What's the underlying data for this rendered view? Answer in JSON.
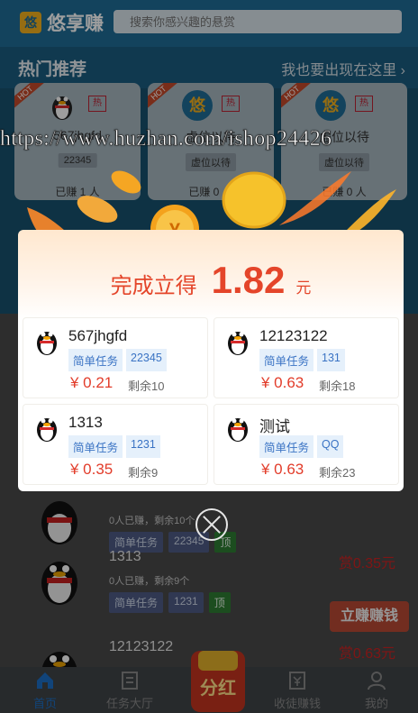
{
  "app": {
    "name": "悠享赚",
    "logo_char": "悠"
  },
  "search": {
    "placeholder": "搜索你感兴趣的悬赏"
  },
  "hot": {
    "title": "热门推荐",
    "link": "我也要出现在这里 ›",
    "cards": [
      {
        "ribbon": "HOT",
        "tag": "热",
        "name": "567jhgfd",
        "sub": "22345",
        "done": "已赚 1 人"
      },
      {
        "ribbon": "HOT",
        "tag": "热",
        "name": "虚位以待",
        "sub": "虚位以待",
        "done": "已赚 0 人"
      },
      {
        "ribbon": "HOT",
        "tag": "热",
        "name": "虚位以待",
        "sub": "虚位以待",
        "done": "已赚 0 人"
      }
    ]
  },
  "list": [
    {
      "name": "",
      "meta": "0人已赚，剩余10个",
      "tags": [
        "简单任务",
        "22345",
        "顶"
      ],
      "reward": "",
      "button": ""
    },
    {
      "name": "1313",
      "meta": "0人已赚，剩余9个",
      "tags": [
        "简单任务",
        "1231",
        "顶"
      ],
      "reward": "赏0.35元",
      "button": "立赚赚钱"
    },
    {
      "name": "12123122",
      "meta": "",
      "tags": [],
      "reward": "赏0.63元",
      "button": ""
    }
  ],
  "tabs": [
    {
      "label": "首页",
      "icon": "home-icon"
    },
    {
      "label": "任务大厅",
      "icon": "list-icon"
    },
    {
      "label": "收徒赚钱",
      "icon": "money-icon"
    },
    {
      "label": "我的",
      "icon": "user-icon"
    }
  ],
  "fab": {
    "label": "分红"
  },
  "modal": {
    "prefix": "完成立得",
    "amount": "1.82",
    "unit": "元",
    "tasks": [
      {
        "name": "567jhgfd",
        "tags": [
          "简单任务",
          "22345"
        ],
        "price": "¥ 0.21",
        "remain": "剩余10"
      },
      {
        "name": "12123122",
        "tags": [
          "简单任务",
          "131"
        ],
        "price": "¥ 0.63",
        "remain": "剩余18"
      },
      {
        "name": "1313",
        "tags": [
          "简单任务",
          "1231"
        ],
        "price": "¥ 0.35",
        "remain": "剩余9"
      },
      {
        "name": "测试",
        "tags": [
          "简单任务",
          "QQ"
        ],
        "price": "¥ 0.63",
        "remain": "剩余23"
      }
    ]
  },
  "coin": {
    "symbol": "¥"
  },
  "watermark": "https://www.huzhan.com/ishop24426",
  "colors": {
    "primary": "#1f6d96",
    "accent": "#e4452a",
    "tag_bg": "#e5f0fb",
    "tag_text": "#3a73c4",
    "coin": "#f2b01e"
  }
}
